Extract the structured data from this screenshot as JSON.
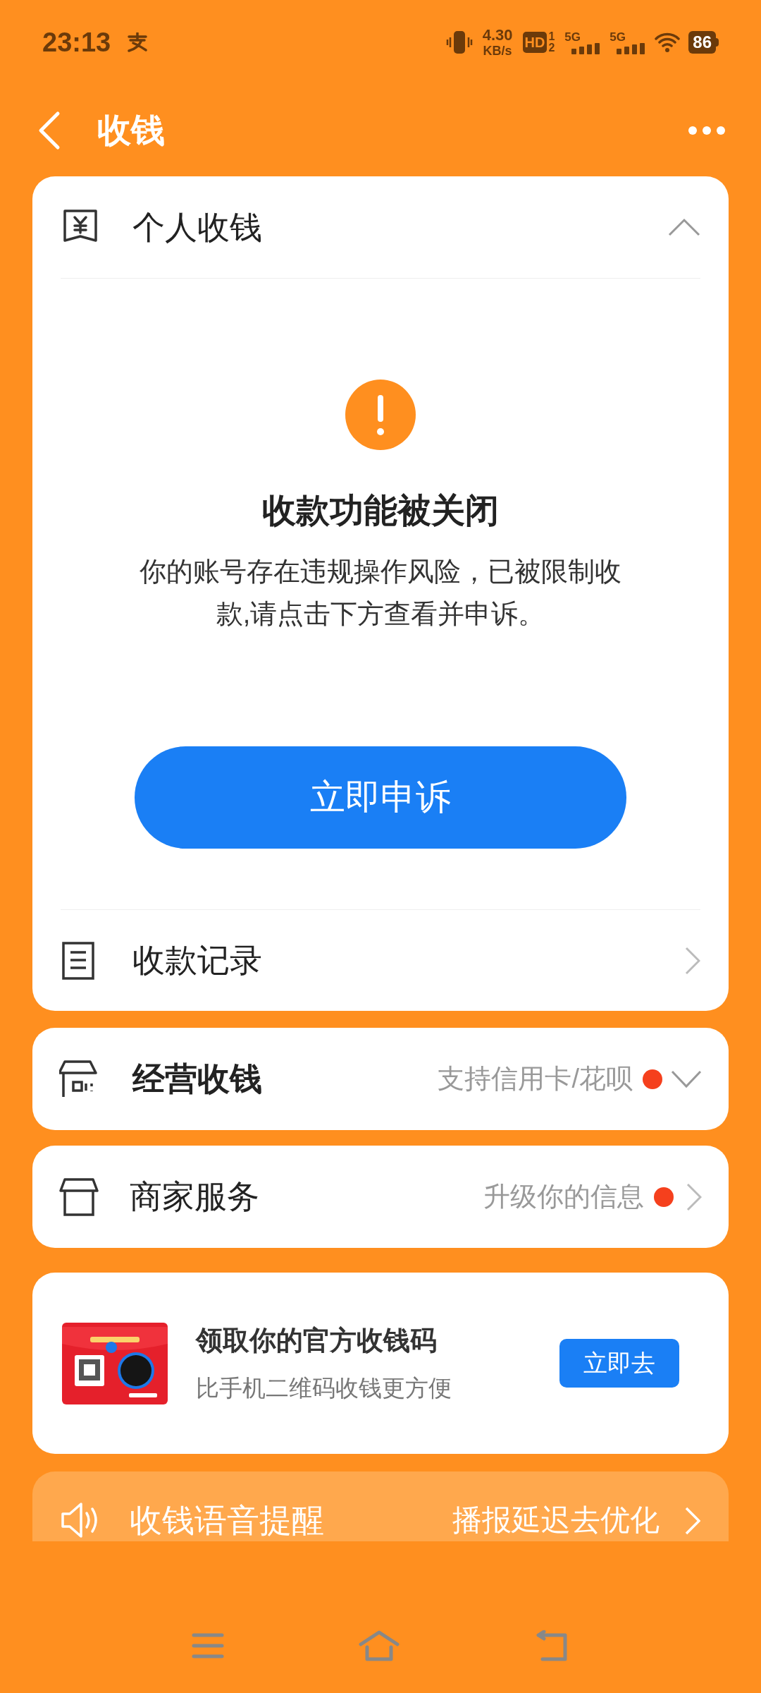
{
  "status_bar": {
    "time": "23:13",
    "speed_value": "4.30",
    "speed_unit": "KB/s",
    "hd": "HD",
    "hd_slots": [
      "1",
      "2"
    ],
    "networks": [
      "5G",
      "5G"
    ],
    "battery": "86"
  },
  "header": {
    "title": "收钱"
  },
  "personal": {
    "title": "个人收钱",
    "expanded": true,
    "notice": {
      "title": "收款功能被关闭",
      "message": "你的账号存在违规操作风险，已被限制收款,请点击下方查看并申诉。"
    },
    "appeal_button": "立即申诉",
    "record_row": "收款记录"
  },
  "service_rows": [
    {
      "kind": "expandable",
      "title": "经营收钱",
      "hint": "支持信用卡/花呗",
      "badge_dot": true,
      "expanded": false
    },
    {
      "kind": "link",
      "title": "商家服务",
      "hint": "升级你的信息",
      "badge_dot": true
    }
  ],
  "promo": {
    "title": "领取你的官方收钱码",
    "subtitle": "比手机二维码收钱更方便",
    "button": "立即去"
  },
  "voice_row": {
    "title": "收钱语音提醒",
    "hint": "播报延迟去优化"
  }
}
